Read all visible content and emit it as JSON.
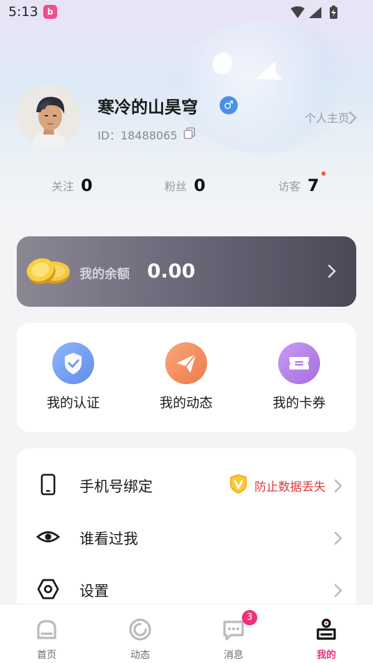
{
  "status_bar": {
    "time": "5:13",
    "app_icon": "b-app-icon"
  },
  "profile": {
    "username": "寒冷的山昊穹",
    "gender_symbol": "♂",
    "user_id": "ID：18488065",
    "homepage_label": "个人主页"
  },
  "stats": {
    "following": {
      "label": "关注",
      "value": "0"
    },
    "fans": {
      "label": "粉丝",
      "value": "0"
    },
    "visitors": {
      "label": "访客",
      "value": "7"
    }
  },
  "balance": {
    "label": "我的余额",
    "value": "0.00"
  },
  "quick_actions": [
    {
      "label": "我的认证",
      "icon": "shield-check-icon",
      "color": "#6f9cf0"
    },
    {
      "label": "我的动态",
      "icon": "paper-plane-icon",
      "color": "#f48a5c"
    },
    {
      "label": "我的卡券",
      "icon": "ticket-icon",
      "color": "#b27ee6"
    }
  ],
  "menu": {
    "phone_binding": {
      "label": "手机号绑定",
      "hint": "防止数据丢失",
      "hint_color": "#e0393e"
    },
    "who_viewed_me": {
      "label": "谁看过我"
    },
    "settings": {
      "label": "设置"
    }
  },
  "bottom_nav": [
    {
      "label": "首页",
      "icon": "home-icon"
    },
    {
      "label": "动态",
      "icon": "moments-icon"
    },
    {
      "label": "消息",
      "icon": "message-icon",
      "badge": "3"
    },
    {
      "label": "我的",
      "icon": "profile-icon",
      "active": true
    }
  ],
  "colors": {
    "accent": "#f0307a",
    "gender_badge": "#4a8fe8"
  }
}
